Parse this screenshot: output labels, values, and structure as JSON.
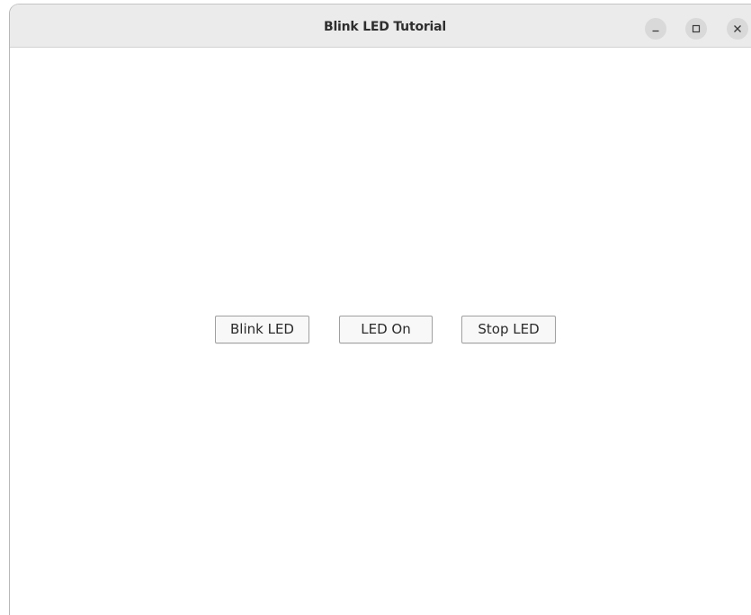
{
  "window": {
    "title": "Blink LED Tutorial"
  },
  "titlebar_buttons": {
    "minimize_icon": "minimize-icon",
    "maximize_icon": "maximize-icon",
    "close_icon": "close-icon"
  },
  "main": {
    "buttons": [
      {
        "label": "Blink LED"
      },
      {
        "label": "LED On"
      },
      {
        "label": "Stop LED"
      }
    ]
  },
  "colors": {
    "titlebar_bg": "#ebebeb",
    "window_bg": "#ffffff",
    "button_bg": "#f8f8f8",
    "button_border": "#a0a0a0",
    "window_control_bg": "#d9d9d9"
  }
}
